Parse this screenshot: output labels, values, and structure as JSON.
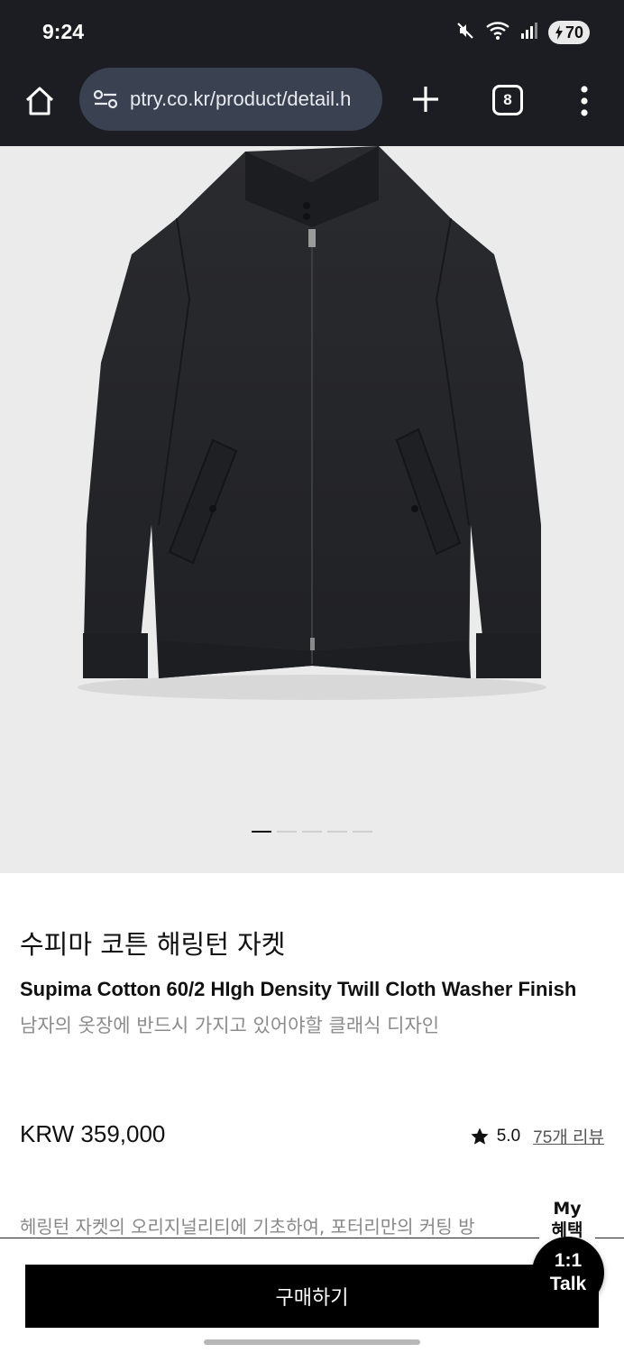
{
  "status_bar": {
    "time": "9:24",
    "battery": "70",
    "icons": [
      "mute-icon",
      "wifi-icon",
      "signal-icon",
      "battery-charging-icon"
    ]
  },
  "browser": {
    "url": "ptry.co.kr/product/detail.h",
    "tab_count": "8",
    "icons": [
      "home-icon",
      "site-settings-icon",
      "plus-icon",
      "tabs-icon",
      "more-vert-icon"
    ]
  },
  "product": {
    "image_description": "black harrington jacket",
    "carousel": {
      "count": 5,
      "active_index": 0
    },
    "title_ko": "수피마 코튼 해링턴 자켓",
    "title_en": "Supima Cotton 60/2 HIgh Density Twill Cloth Washer Finish",
    "subtitle": "남자의 옷장에 반드시 가지고 있어야할 클래식 디자인",
    "price": "KRW 359,000",
    "rating": "5.0",
    "reviews": "75개 리뷰",
    "description": "헤링턴 자켓의 오리지널리티에 기초하여, 포터리만의 커팅 방"
  },
  "actions": {
    "buy_label": "구매하기",
    "benefit_label_1": "My",
    "benefit_label_2": "혜택",
    "talk_label_1": "1:1",
    "talk_label_2": "Talk"
  },
  "colors": {
    "status_bg": "#1b1d23",
    "url_bg": "#3a4150",
    "image_bg": "#ebebeb",
    "buy_bg": "#000000"
  }
}
